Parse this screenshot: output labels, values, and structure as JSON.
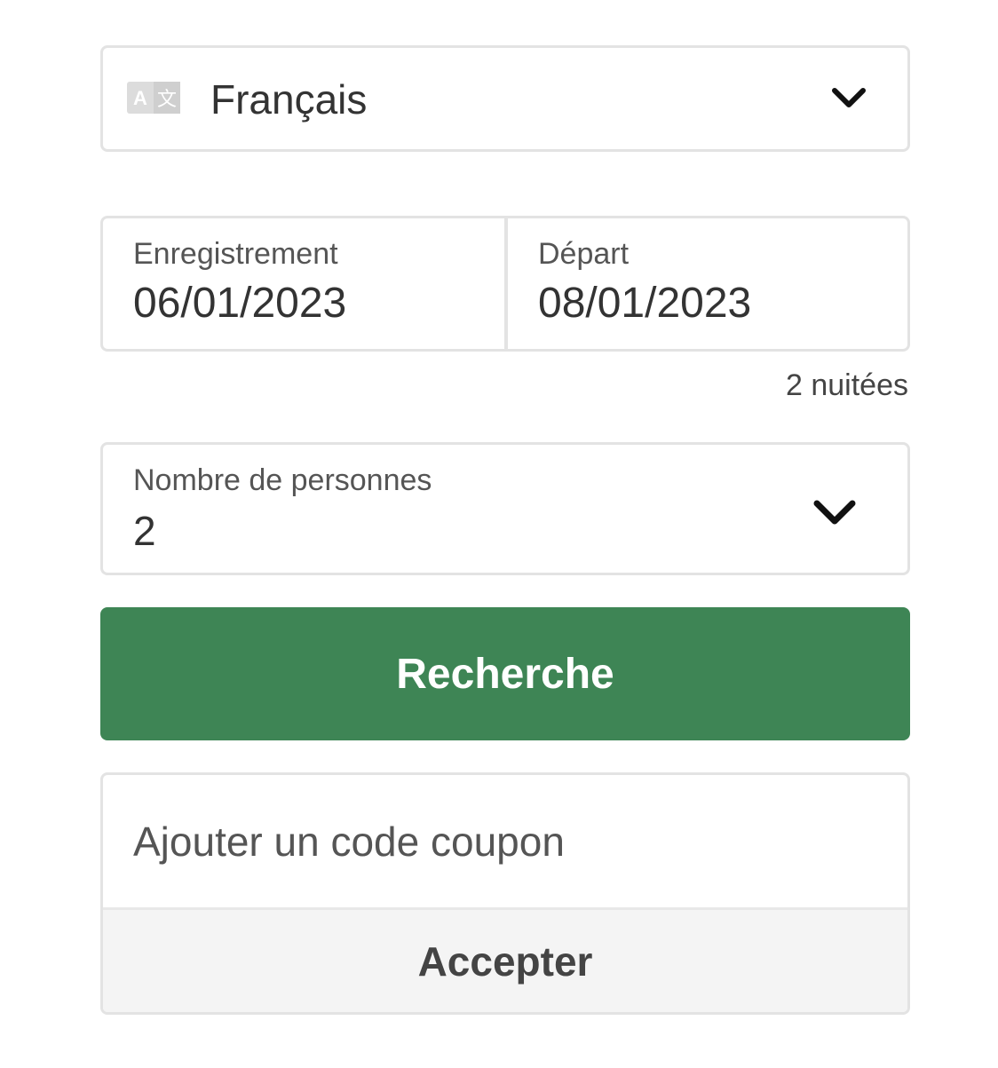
{
  "language": {
    "icon": "translate-icon",
    "value": "Français",
    "chevron_icon": "chevron-down-icon"
  },
  "dates": {
    "checkin": {
      "label": "Enregistrement",
      "value": "06/01/2023"
    },
    "checkout": {
      "label": "Départ",
      "value": "08/01/2023"
    },
    "nights": "2 nuitées"
  },
  "persons": {
    "label": "Nombre de personnes",
    "value": "2",
    "chevron_icon": "chevron-down-icon"
  },
  "search_button": {
    "label": "Recherche",
    "color": "#3e8555"
  },
  "coupon": {
    "placeholder": "Ajouter un code coupon",
    "value": "",
    "accept_label": "Accepter"
  }
}
